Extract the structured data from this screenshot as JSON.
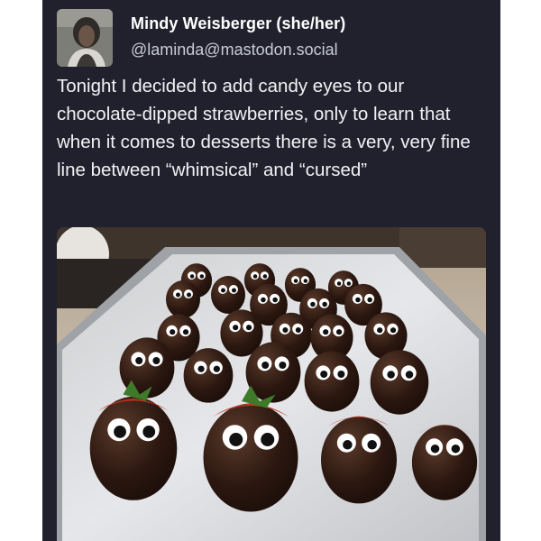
{
  "post": {
    "author_name": "Mindy Weisberger (she/her)",
    "author_handle": "@laminda@mastodon.social",
    "text": "Tonight I decided to add candy eyes to our chocolate-dipped strawberries, only to learn that when it comes to desserts there is a very, very fine line between “whimsical” and “cursed”"
  },
  "icons": {
    "avatar": "profile-photo",
    "media": "chocolate-strawberries-with-candy-eyes-photo"
  },
  "colors": {
    "background": "#20212d",
    "author_name": "#ffffff",
    "handle": "#c9cbd6",
    "text": "#f2f2f5"
  }
}
